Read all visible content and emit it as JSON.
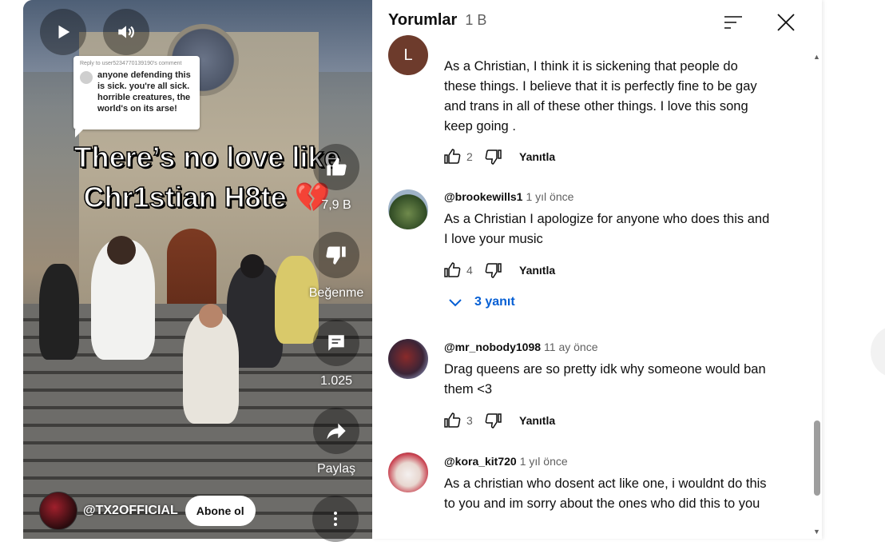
{
  "video": {
    "reply_card": {
      "reply_to": "Reply to user5234770139190's comment",
      "text": "anyone defending this is sick. you're all sick. horrible creatures, the world's on its arse!"
    },
    "overlay_line1": "There’s no love like",
    "overlay_line2": "Chr1stian H8te",
    "overlay_emoji": "💔",
    "like_count": "7,9 B",
    "dislike_label": "Beğenme",
    "comment_count": "1.025",
    "share_label": "Paylaş",
    "channel_name": "@TX2OFFICIAL",
    "subscribe_label": "Abone ol"
  },
  "comments_panel": {
    "title": "Yorumlar",
    "count": "1 B",
    "reply_label": "Yanıtla",
    "comments": [
      {
        "avatar_letter": "L",
        "text": "As a Christian, I think it is sickening that people do these things. I believe that it is perfectly fine to be gay and trans in all of these other things. I love this song keep going .",
        "likes": "2"
      },
      {
        "user": "@brookewills1",
        "time": "1 yıl önce",
        "text": "As a Christian I apologize for anyone who does this and I love your music",
        "likes": "4",
        "replies": "3 yanıt"
      },
      {
        "user": "@mr_nobody1098",
        "time": "11 ay önce",
        "text": "Drag queens are so pretty idk why someone would ban them <3",
        "likes": "3"
      },
      {
        "user": "@kora_kit720",
        "time": "1 yıl önce",
        "text": "As a christian who dosent act like one, i wouldnt do this to you and im sorry about the ones who did this to you"
      }
    ]
  },
  "colors": {
    "link_blue": "#065fd4",
    "secondary_text": "#606060",
    "avatar_l_bg": "#6d3b2c"
  },
  "icons": [
    "play-icon",
    "volume-icon",
    "thumb-up-icon",
    "thumb-down-icon",
    "comment-icon",
    "share-icon",
    "more-vert-icon",
    "sort-icon",
    "close-icon",
    "chevron-down-icon"
  ]
}
